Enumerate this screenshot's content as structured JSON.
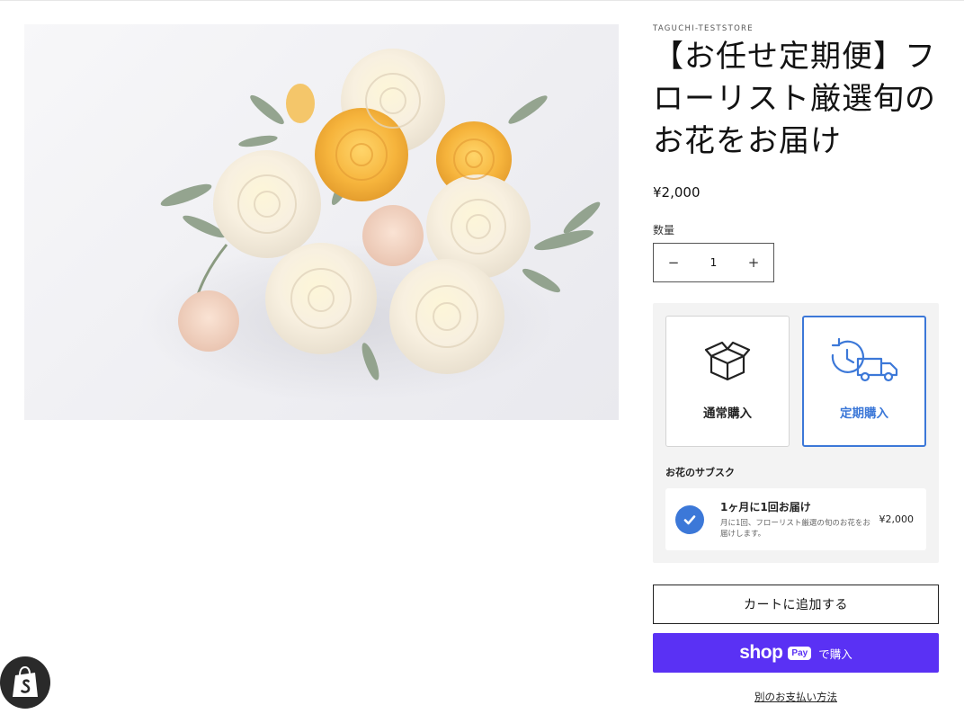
{
  "store": {
    "vendor": "TAGUCHI-TESTSTORE"
  },
  "product": {
    "title": "【お任せ定期便】フローリスト厳選旬のお花をお届け",
    "price": "¥2,000",
    "image_alt": "white-and-yellow-rose-bouquet"
  },
  "quantity": {
    "label": "数量",
    "value": "1",
    "minus": "−",
    "plus": "+"
  },
  "purchase_options": {
    "one_time": {
      "label": "通常購入",
      "icon": "box-icon",
      "selected": false
    },
    "subscription": {
      "label": "定期購入",
      "icon": "clock-truck-icon",
      "selected": true
    }
  },
  "subscription_plan": {
    "heading": "お花のサブスク",
    "name": "1ヶ月に1回お届け",
    "description": "月に1回、フローリスト厳選の旬のお花をお届けします。",
    "price": "¥2,000",
    "selected": true
  },
  "actions": {
    "add_to_cart": "カートに追加する",
    "shop_pay_word": "shop",
    "shop_pay_pill": "Pay",
    "shop_pay_suffix": "で購入",
    "more_payment": "別のお支払い方法"
  },
  "colors": {
    "accent": "#3c78d8",
    "shop_pay": "#5a31f4",
    "panel": "#f3f3f3"
  }
}
